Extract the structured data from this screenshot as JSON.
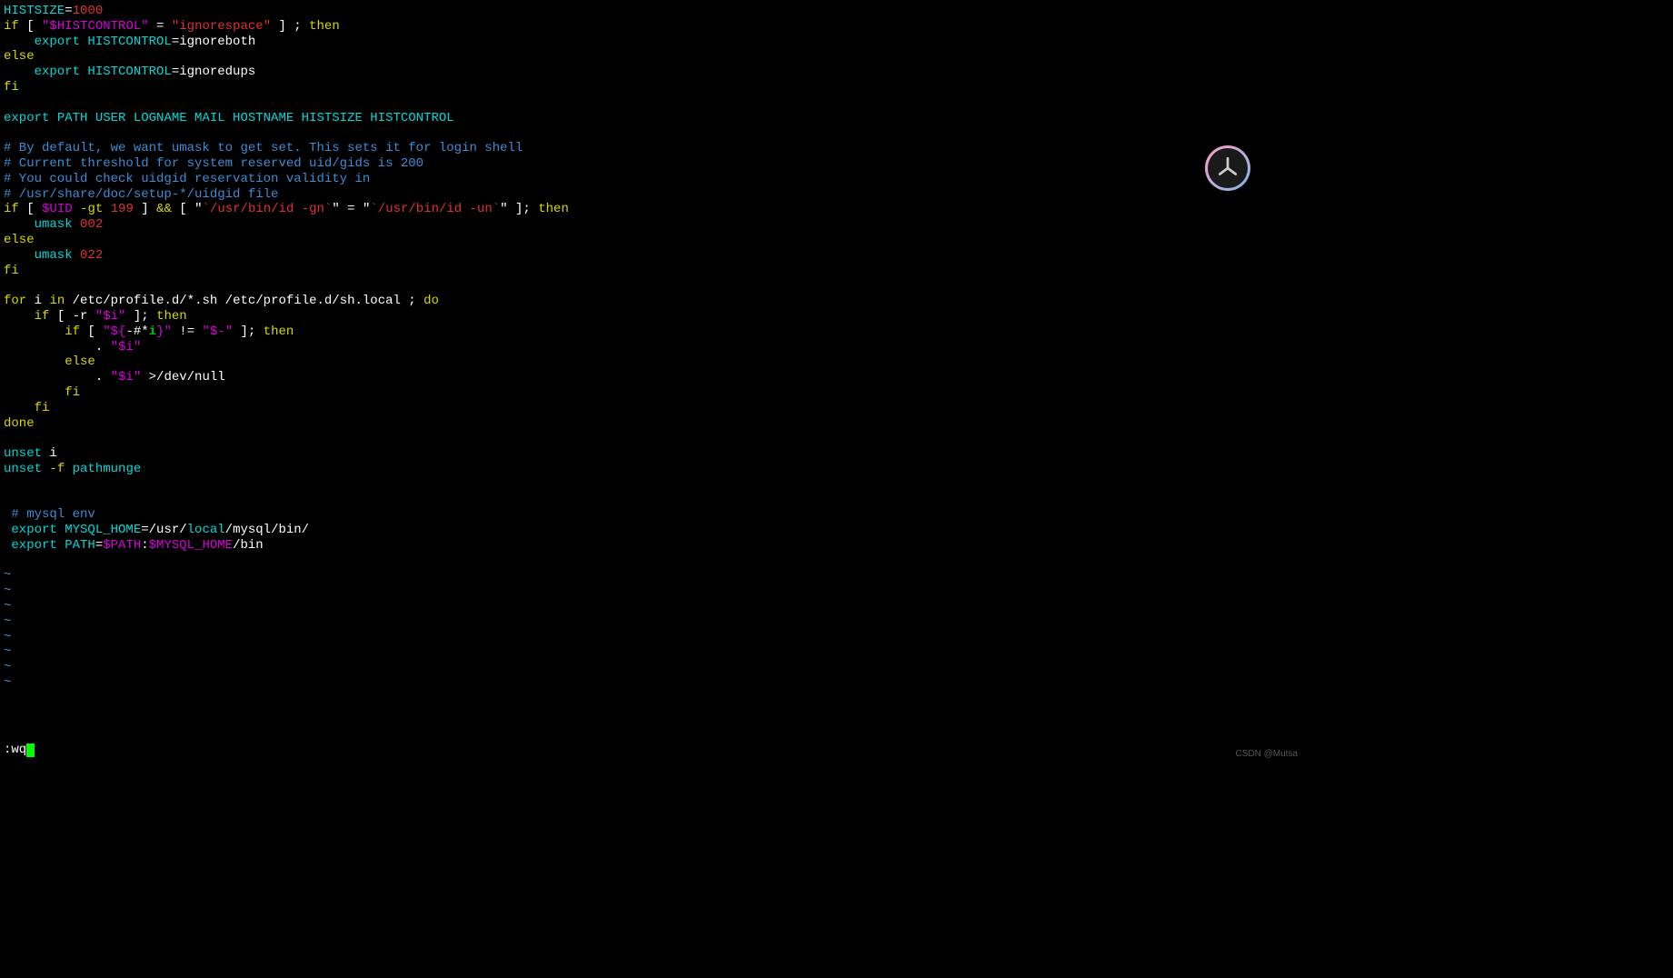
{
  "lines": {
    "l1_histsize": "HISTSIZE",
    "l1_eq": "=",
    "l1_val": "1000",
    "l2_if": "if",
    "l2_bracket1": " [ ",
    "l2_var": "\"$HISTCONTROL\"",
    "l2_eq": " = ",
    "l2_str": "\"ignorespace\"",
    "l2_bracket2": " ] ; ",
    "l2_then": "then",
    "l3_export": "    export",
    "l3_var": " HISTCONTROL",
    "l3_eq": "=",
    "l3_val": "ignoreboth",
    "l4_else": "else",
    "l5_export": "    export",
    "l5_var": " HISTCONTROL",
    "l5_eq": "=",
    "l5_val": "ignoredups",
    "l6_fi": "fi",
    "l7_blank": "",
    "l8_export": "export",
    "l8_vars": " PATH USER LOGNAME MAIL HOSTNAME HISTSIZE HISTCONTROL",
    "l9_blank": "",
    "l10_comment": "# By default, we want umask to get set. This sets it for login shell",
    "l11_comment": "# Current threshold for system reserved uid/gids is 200",
    "l12_comment": "# You could check uidgid reservation validity in",
    "l13_comment": "# /usr/share/doc/setup-*/uidgid file",
    "l14_if": "if",
    "l14_b1": " [ ",
    "l14_uid": "$UID",
    "l14_gt": " -gt ",
    "l14_num": "199",
    "l14_b2": " ] ",
    "l14_and": "&&",
    "l14_b3": " [ ",
    "l14_q1": "\"",
    "l14_bt1": "`/usr/bin/id -gn`",
    "l14_q2": "\"",
    "l14_eq": " = ",
    "l14_q3": "\"",
    "l14_bt2": "`/usr/bin/id -un`",
    "l14_q4": "\"",
    "l14_b4": " ]; ",
    "l14_then": "then",
    "l15_umask": "    umask",
    "l15_val": " 002",
    "l16_else": "else",
    "l17_umask": "    umask",
    "l17_val": " 022",
    "l18_fi": "fi",
    "l19_blank": "",
    "l20_for": "for",
    "l20_i": " i ",
    "l20_in": "in",
    "l20_path": " /etc/profile.d/*.sh /etc/profile.d/sh.local ; ",
    "l20_do": "do",
    "l21_if": "    if",
    "l21_b1": " [ -r ",
    "l21_var": "\"$i\"",
    "l21_b2": " ]; ",
    "l21_then": "then",
    "l22_if": "        if",
    "l22_b1": " [ ",
    "l22_q1": "\"${",
    "l22_hash": "-#*",
    "l22_i": "i",
    "l22_close": "}\"",
    "l22_ne": " != ",
    "l22_str": "\"$-\"",
    "l22_b2": " ]; ",
    "l22_then": "then",
    "l23_dot": "            . ",
    "l23_var": "\"$i\"",
    "l24_else": "        else",
    "l25_dot": "            . ",
    "l25_var": "\"$i\"",
    "l25_redir": " >",
    "l25_null": "/dev/null",
    "l26_fi": "        fi",
    "l27_fi": "    fi",
    "l28_done": "done",
    "l29_blank": "",
    "l30_unset": "unset",
    "l30_i": " i",
    "l31_unset": "unset",
    "l31_f": " -f",
    "l31_path": " pathmunge",
    "l32_blank": "",
    "l33_blank": "",
    "l34_comment": " # mysql env",
    "l35_export": " export",
    "l35_var": " MYSQL_HOME",
    "l35_eq": "=",
    "l35_p1": "/usr/",
    "l35_local": "local",
    "l35_p2": "/mysql/bin/",
    "l36_export": " export",
    "l36_var": " PATH",
    "l36_eq": "=",
    "l36_path": "$PATH",
    "l36_colon": ":",
    "l36_home": "$MYSQL_HOME",
    "l36_bin": "/bin"
  },
  "tildes": [
    "~",
    "~",
    "~",
    "~",
    "~",
    "~",
    "~",
    "~"
  ],
  "command": ":wq",
  "watermark": "CSDN @Mutsa"
}
